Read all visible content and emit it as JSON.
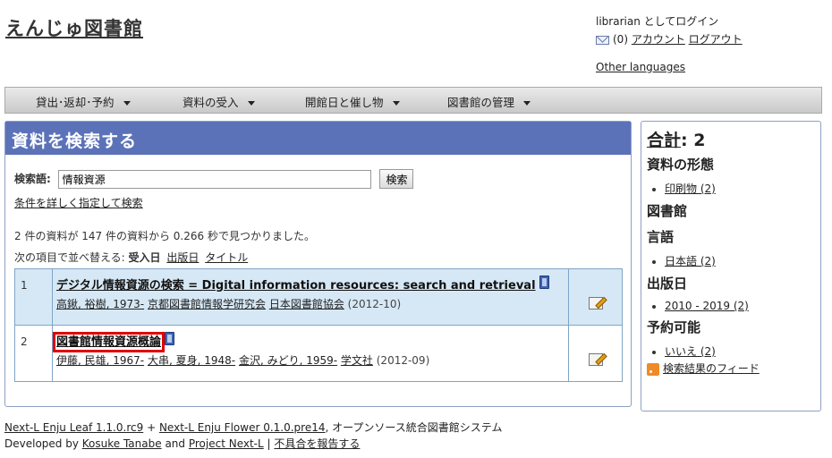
{
  "header": {
    "site_title": "えんじゅ図書館",
    "user_text": "librarian としてログイン",
    "message_count": "(0)",
    "account_link": "アカウント",
    "logout_link": "ログアウト",
    "other_languages": "Other languages"
  },
  "nav": {
    "items": [
      {
        "label": "貸出･返却･予約"
      },
      {
        "label": "資料の受入"
      },
      {
        "label": "開館日と催し物"
      },
      {
        "label": "図書館の管理"
      }
    ]
  },
  "main": {
    "heading": "資料を検索する",
    "search_label": "検索語:",
    "search_value": "情報資源",
    "search_button": "検索",
    "advanced_link": "条件を詳しく指定して検索",
    "result_summary": "2 件の資料が 147 件の資料から 0.266 秒で見つかりました。",
    "sort_prefix": "次の項目で並べ替える:",
    "sort_current": "受入日",
    "sort_options": [
      "出版日",
      "タイトル"
    ],
    "results": [
      {
        "num": "1",
        "title": "デジタル情報資源の検索 = Digital information resources: search and retrieval",
        "authors": [
          "高鍬, 裕樹, 1973-",
          "京都図書館情報学研究会",
          "日本図書館協会"
        ],
        "date": "(2012-10)"
      },
      {
        "num": "2",
        "title": "図書館情報資源概論",
        "authors": [
          "伊藤, 民雄, 1967-",
          "大串, 夏身, 1948-",
          "金沢, みどり, 1959-",
          "学文社"
        ],
        "date": "(2012-09)"
      }
    ]
  },
  "sidebar": {
    "total_label": "合計",
    "total_value": ": 2",
    "facets": [
      {
        "heading": "資料の形態",
        "items": [
          "印刷物 (2)"
        ]
      },
      {
        "heading": "図書館",
        "items": []
      },
      {
        "heading": "言語",
        "items": [
          "日本語 (2)"
        ]
      },
      {
        "heading": "出版日",
        "items": [
          "2010 - 2019 (2)"
        ]
      },
      {
        "heading": "予約可能",
        "items": [
          "いいえ (2)"
        ]
      }
    ],
    "feed_link": "検索結果のフィード"
  },
  "footer": {
    "leaf_link": "Next-L Enju Leaf 1.1.0.rc9",
    "plus": "+",
    "flower_link": "Next-L Enju Flower 0.1.0.pre14",
    "system_text": ", オープンソース統合図書館システム",
    "developed_by": "Developed by",
    "dev1": "Kosuke Tanabe",
    "and": "and",
    "dev2": "Project Next-L",
    "sep": "|",
    "report_link": "不具合を報告する"
  },
  "colors": {
    "nav_gradient_top": "#eaeaea",
    "header_bar": "#5c72b8",
    "row_blue": "#d6e8f5",
    "highlight": "#e00000"
  }
}
